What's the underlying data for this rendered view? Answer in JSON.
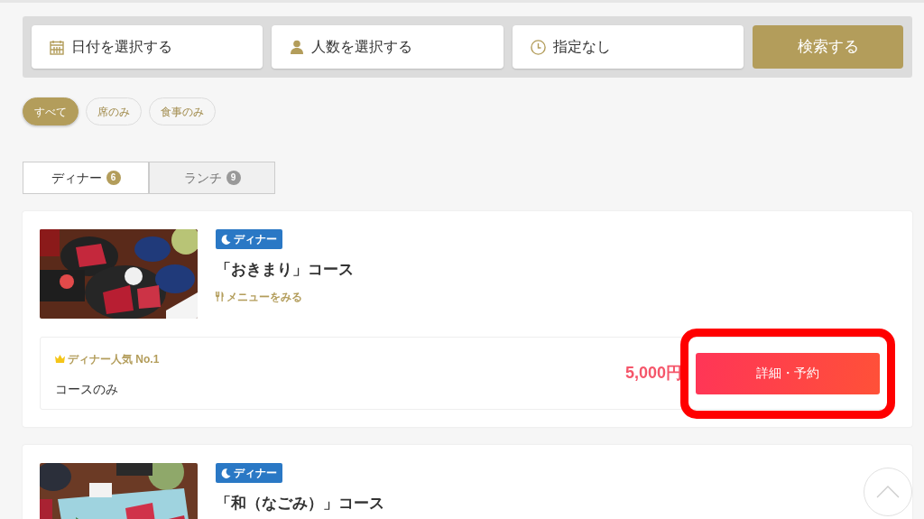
{
  "search_bar": {
    "fields": [
      {
        "kind": "date",
        "label": "日付を選択する"
      },
      {
        "kind": "people",
        "label": "人数を選択する"
      },
      {
        "kind": "time",
        "label": "指定なし"
      }
    ],
    "button": "検索する"
  },
  "filters": [
    {
      "label": "すべて",
      "selected": true
    },
    {
      "label": "席のみ",
      "selected": false
    },
    {
      "label": "食事のみ",
      "selected": false
    }
  ],
  "tabs": [
    {
      "label": "ディナー",
      "count": "6",
      "selected": true
    },
    {
      "label": "ランチ",
      "count": "9",
      "selected": false
    }
  ],
  "courses": [
    {
      "badge": "ディナー",
      "title": "「おきまり」コース",
      "menu_link": "メニューをみる",
      "plan": {
        "ranking": "ディナー人気 No.1",
        "name": "コースのみ",
        "price": "5,000円",
        "button": "詳細・予約",
        "highlighted": true
      }
    },
    {
      "badge": "ディナー",
      "title": "「和（なごみ）」コース"
    }
  ]
}
